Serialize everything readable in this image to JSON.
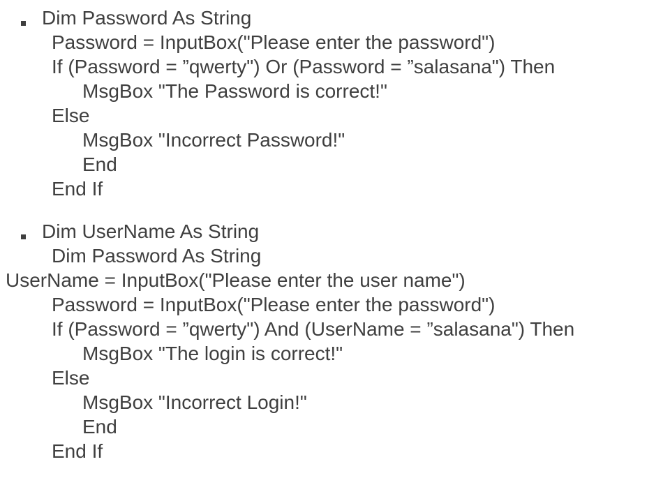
{
  "block1": {
    "l1": "Dim Password As String",
    "l2": "Password = InputBox(\"Please enter the password\")",
    "l3": "If (Password = ”qwerty\") Or (Password = ”salasana\") Then",
    "l4": "MsgBox \"The Password is correct!\"",
    "l5": "Else",
    "l6": "MsgBox \"Incorrect Password!\"",
    "l7": "End",
    "l8": "End If"
  },
  "block2": {
    "l1": "Dim UserName As String",
    "l2": "Dim Password As String",
    "l3": "UserName = InputBox(\"Please enter the user name\")",
    "l4": "Password = InputBox(\"Please enter the password\")",
    "l5": "If (Password = ”qwerty\") And (UserName = ”salasana\") Then",
    "l6": "MsgBox \"The login is correct!\"",
    "l7": "Else",
    "l8": "MsgBox \"Incorrect Login!\"",
    "l9": "End",
    "l10": "End If"
  }
}
